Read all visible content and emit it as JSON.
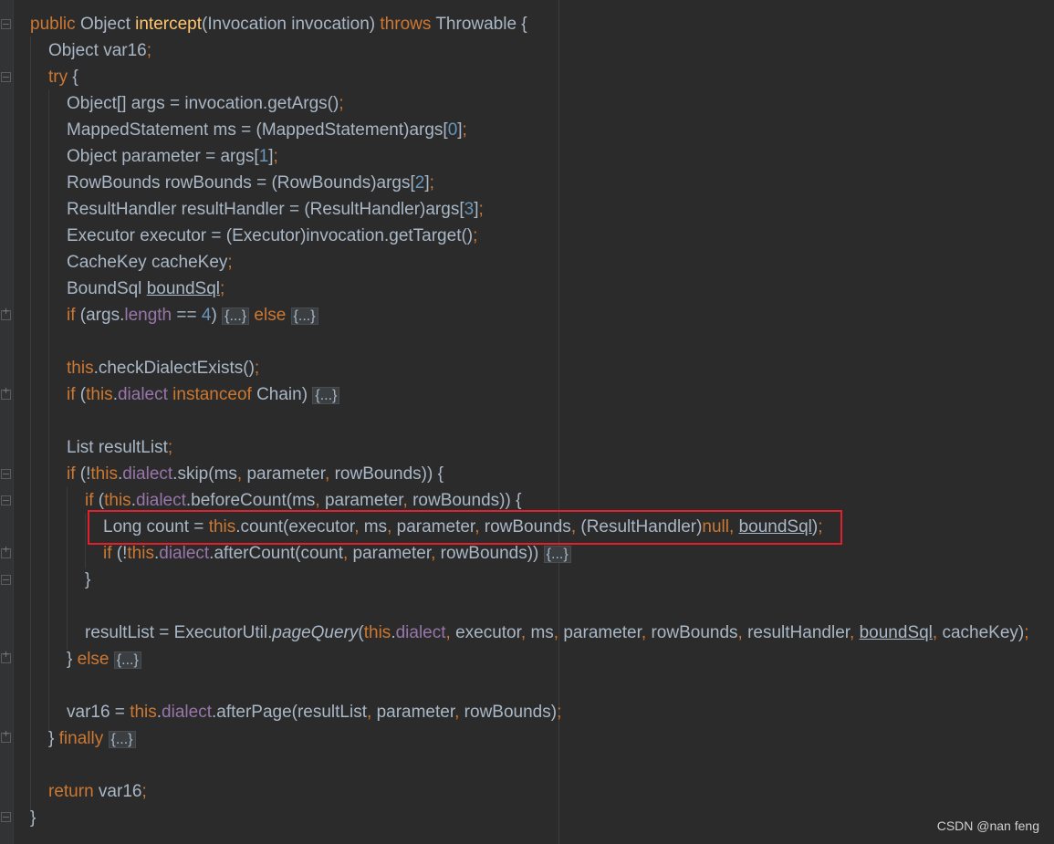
{
  "editor": {
    "lines": {
      "l1": [
        "public",
        "Object",
        "intercept",
        "(Invocation invocation)",
        "throws",
        "Throwable {"
      ],
      "l2": [
        "Object var16",
        ";"
      ],
      "l3": [
        "try",
        "{"
      ],
      "l4": [
        "Object[] args = invocation.getArgs()",
        ";"
      ],
      "l5": [
        "MappedStatement ms = (MappedStatement)args[",
        "0",
        "]",
        ";"
      ],
      "l6": [
        "Object parameter = args[",
        "1",
        "]",
        ";"
      ],
      "l7": [
        "RowBounds rowBounds = (RowBounds)args[",
        "2",
        "]",
        ";"
      ],
      "l8": [
        "ResultHandler resultHandler = (ResultHandler)args[",
        "3",
        "]",
        ";"
      ],
      "l9": [
        "Executor executor = (Executor)invocation.getTarget()",
        ";"
      ],
      "l10": [
        "CacheKey cacheKey",
        ";"
      ],
      "l11": [
        "BoundSql ",
        "boundSql",
        ";"
      ],
      "l12": [
        "if",
        "(args.",
        "length",
        "==",
        "4",
        ")",
        "{...}",
        "else",
        "{...}"
      ],
      "l14": [
        "this",
        ".checkDialectExists()",
        ";"
      ],
      "l15": [
        "if",
        "(",
        "this",
        ".",
        "dialect",
        "instanceof",
        "Chain)",
        "{...}"
      ],
      "l17": [
        "List resultList",
        ";"
      ],
      "l18": [
        "if",
        "(!",
        "this",
        ".",
        "dialect",
        ".skip(ms",
        ",",
        "parameter",
        ",",
        "rowBounds)) {"
      ],
      "l19": [
        "if",
        "(",
        "this",
        ".",
        "dialect",
        ".beforeCount(ms",
        ",",
        "parameter",
        ",",
        "rowBounds)) {"
      ],
      "l20": [
        "Long count = ",
        "this",
        ".count(executor",
        ",",
        "ms",
        ",",
        "parameter",
        ",",
        "rowBounds",
        ",",
        "(ResultHandler)",
        "null",
        ",",
        "boundSql",
        ")",
        ";"
      ],
      "l21": [
        "if",
        "(!",
        "this",
        ".",
        "dialect",
        ".afterCount(count",
        ",",
        "parameter",
        ",",
        "rowBounds))",
        "{...}"
      ],
      "l22": [
        "}"
      ],
      "l24": [
        "resultList = ExecutorUtil.",
        "pageQuery",
        "(",
        "this",
        ".",
        "dialect",
        ",",
        "executor",
        ",",
        "ms",
        ",",
        "parameter",
        ",",
        "rowBounds",
        ",",
        "resultHandler",
        ",",
        "boundSql",
        ",",
        "cacheKey)",
        ";"
      ],
      "l25": [
        "}",
        "else",
        "{...}"
      ],
      "l27": [
        "var16 = ",
        "this",
        ".",
        "dialect",
        ".afterPage(resultList",
        ",",
        "parameter",
        ",",
        "rowBounds)",
        ";"
      ],
      "l28": [
        "}",
        "finally",
        "{...}"
      ],
      "l30": [
        "return",
        "var16",
        ";"
      ],
      "l31": [
        "}"
      ]
    }
  },
  "watermark": "CSDN @nan feng",
  "colors": {
    "background": "#2b2b2b",
    "keyword": "#cc7832",
    "method": "#ffc66d",
    "field": "#9876aa",
    "number": "#6897bb",
    "text": "#a9b7c6",
    "highlight_box": "#e0202a"
  }
}
